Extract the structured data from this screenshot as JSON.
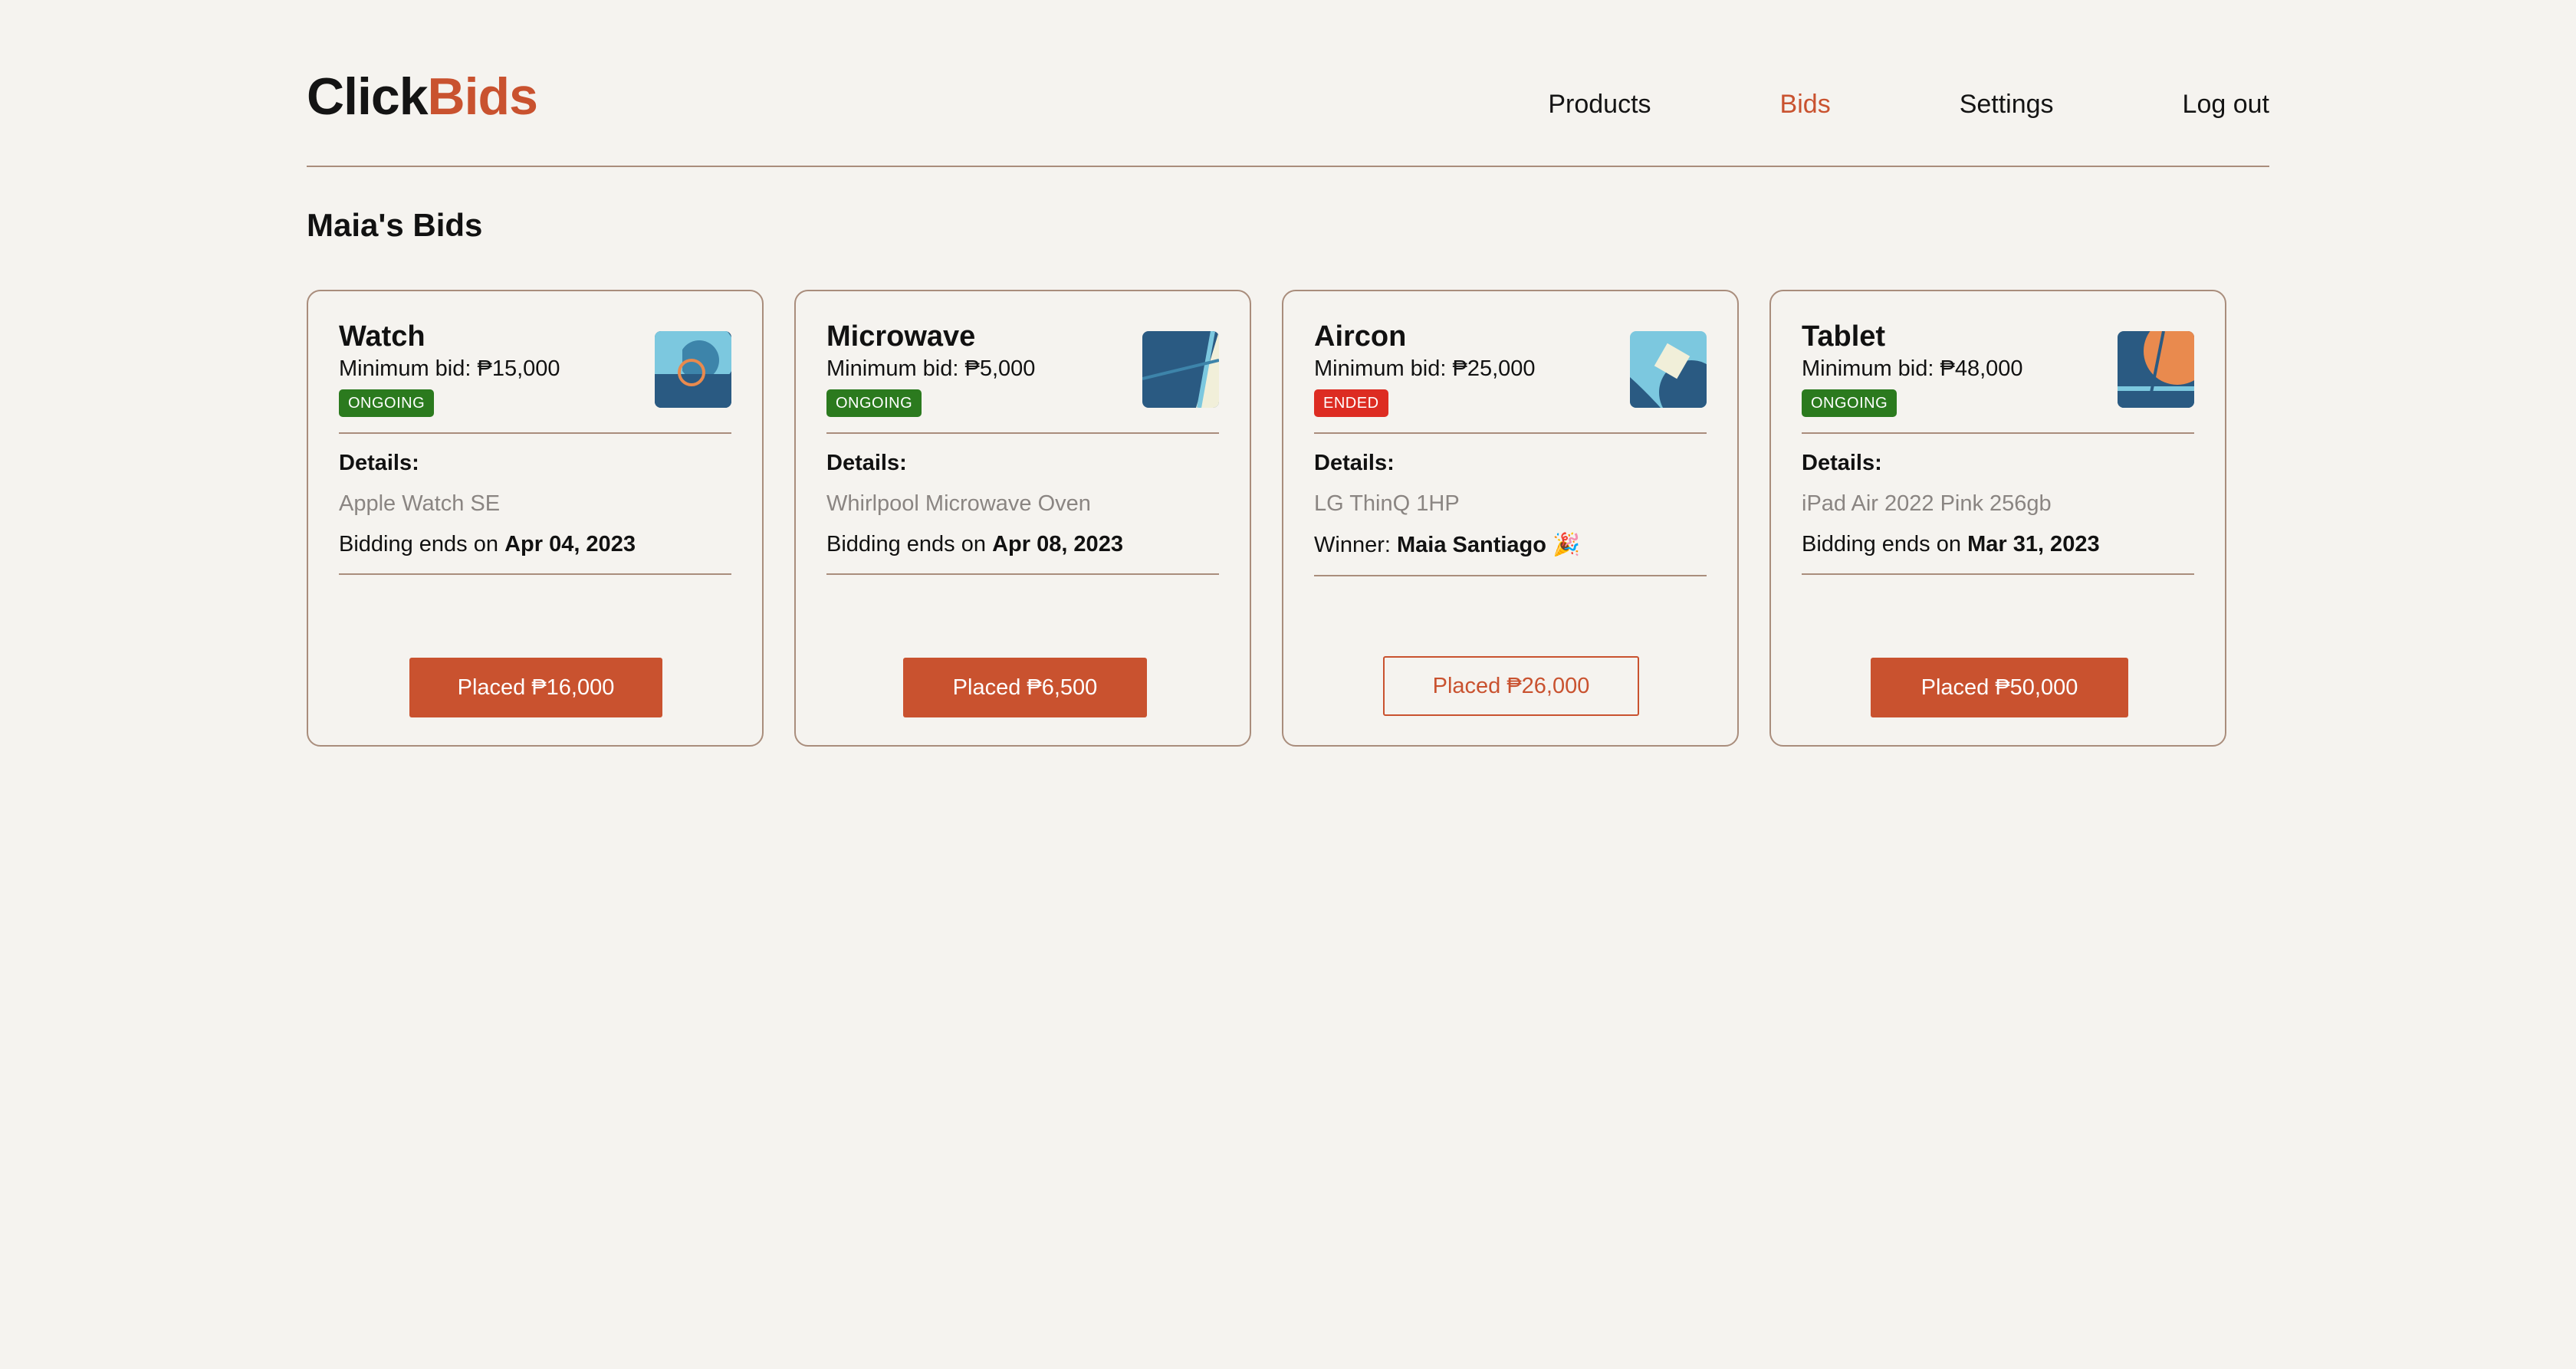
{
  "brand": {
    "part1": "Click",
    "part2": "Bids",
    "accent_color": "#c9522f"
  },
  "nav": {
    "items": [
      {
        "label": "Products",
        "active": false
      },
      {
        "label": "Bids",
        "active": true
      },
      {
        "label": "Settings",
        "active": false
      },
      {
        "label": "Log out",
        "active": false
      }
    ]
  },
  "page_title": "Maia's Bids",
  "cards": [
    {
      "title": "Watch",
      "min_bid_label": "Minimum bid: ",
      "min_bid_value": "₱15,000",
      "status": "ONGOING",
      "details_label": "Details:",
      "details": "Apple Watch SE",
      "footer_prefix": "Bidding ends on ",
      "footer_value": "Apr 04, 2023",
      "footer_suffix": "",
      "button": "Placed ₱16,000",
      "thumb_icon": "abstract-watch-icon"
    },
    {
      "title": "Microwave",
      "min_bid_label": "Minimum bid: ",
      "min_bid_value": "₱5,000",
      "status": "ONGOING",
      "details_label": "Details:",
      "details": "Whirlpool Microwave Oven",
      "footer_prefix": "Bidding ends on ",
      "footer_value": "Apr 08, 2023",
      "footer_suffix": "",
      "button": "Placed ₱6,500",
      "thumb_icon": "abstract-microwave-icon"
    },
    {
      "title": "Aircon",
      "min_bid_label": "Minimum bid: ",
      "min_bid_value": "₱25,000",
      "status": "ENDED",
      "details_label": "Details:",
      "details": "LG ThinQ 1HP",
      "footer_prefix": "Winner: ",
      "footer_value": "Maia Santiago",
      "footer_suffix": " 🎉",
      "button": "Placed ₱26,000",
      "thumb_icon": "abstract-aircon-icon"
    },
    {
      "title": "Tablet",
      "min_bid_label": "Minimum bid: ",
      "min_bid_value": "₱48,000",
      "status": "ONGOING",
      "details_label": "Details:",
      "details": "iPad Air 2022 Pink 256gb",
      "footer_prefix": "Bidding ends on ",
      "footer_value": "Mar 31, 2023",
      "footer_suffix": "",
      "button": "Placed ₱50,000",
      "thumb_icon": "abstract-tablet-icon"
    }
  ],
  "colors": {
    "background": "#f5f3ef",
    "ongoing": "#2b7a1e",
    "ended": "#dd2c22",
    "border": "#a98d7c",
    "thumb_dark": "#2a5a82",
    "thumb_light": "#7cc8df",
    "thumb_orange": "#e98a4e",
    "thumb_cream": "#f1efd9"
  }
}
